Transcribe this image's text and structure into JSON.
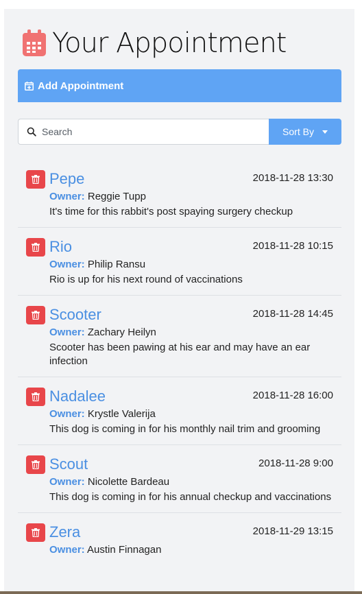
{
  "header": {
    "title": "Your Appointment",
    "icon": "calendar-icon",
    "icon_color": "#f07272"
  },
  "add_bar": {
    "label": "Add Appointment",
    "icon": "calendar-plus-icon",
    "color": "#5fa4f4"
  },
  "search": {
    "placeholder": "Search",
    "value": ""
  },
  "sort": {
    "label": "Sort By"
  },
  "appointments": [
    {
      "pet": "Pepe",
      "date": "2018-11-28 13:30",
      "owner_label": "Owner:",
      "owner": "Reggie Tupp",
      "notes": "It's time for this rabbit's post spaying surgery checkup"
    },
    {
      "pet": "Rio",
      "date": "2018-11-28 10:15",
      "owner_label": "Owner:",
      "owner": "Philip Ransu",
      "notes": "Rio is up for his next round of vaccinations"
    },
    {
      "pet": "Scooter",
      "date": "2018-11-28 14:45",
      "owner_label": "Owner:",
      "owner": "Zachary Heilyn",
      "notes": "Scooter has been pawing at his ear and may have an ear infection"
    },
    {
      "pet": "Nadalee",
      "date": "2018-11-28 16:00",
      "owner_label": "Owner:",
      "owner": "Krystle Valerija",
      "notes": "This dog is coming in for his monthly nail trim and grooming"
    },
    {
      "pet": "Scout",
      "date": "2018-11-28 9:00",
      "owner_label": "Owner:",
      "owner": "Nicolette Bardeau",
      "notes": "This dog is coming in for his annual checkup and vaccinations"
    },
    {
      "pet": "Zera",
      "date": "2018-11-29 13:15",
      "owner_label": "Owner:",
      "owner": "Austin Finnagan",
      "notes": ""
    }
  ],
  "colors": {
    "accent": "#5fa4f4",
    "pet_name": "#4a8fe2",
    "delete": "#e8464a",
    "background": "#f2f3f5"
  }
}
